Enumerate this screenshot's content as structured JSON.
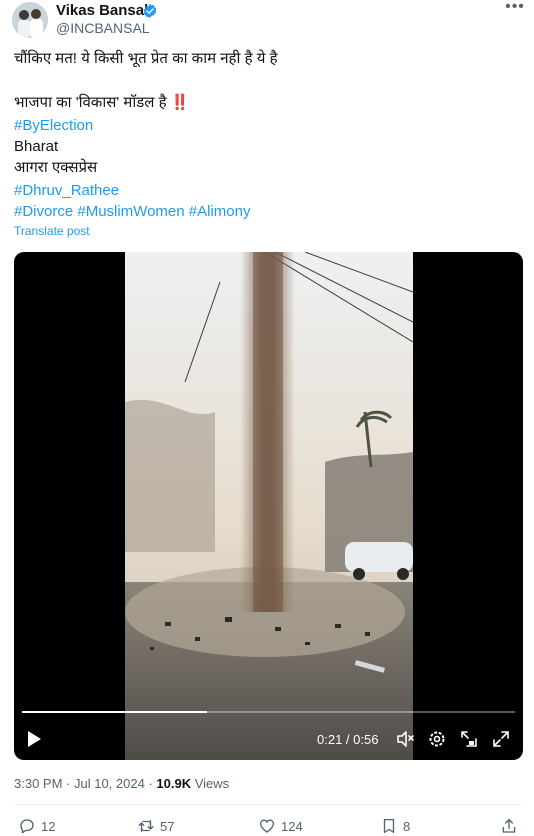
{
  "author": {
    "name": "Vikas Bansal",
    "handle": "@INCBANSAL"
  },
  "tweet": {
    "line1": "चौंकिए मत! ये किसी भूत प्रेत का काम नही है ये है",
    "line2": "भाजपा का 'विकास' मॉडल है",
    "line2_emoji": "‼️",
    "hashtag1": "#ByElection",
    "line4": "Bharat",
    "line5": "आगरा एक्सप्रेस",
    "hashtag2": "#Dhruv_Rathee",
    "hashtag3": "#Divorce",
    "hashtag4": "#MuslimWomen",
    "hashtag5": "#Alimony",
    "translate_label": "Translate post"
  },
  "video": {
    "current_time": "0:21",
    "separator": " / ",
    "duration": "0:56",
    "progress": 0.375
  },
  "meta": {
    "time": "3:30 PM",
    "dot": " · ",
    "date": "Jul 10, 2024",
    "views_count": "10.9K",
    "views_label": " Views"
  },
  "actions": {
    "replies": "12",
    "reposts": "57",
    "likes": "124",
    "bookmarks": "8"
  },
  "colors": {
    "accent": "#1d9bf0",
    "secondary_text": "#536471",
    "primary_text": "#0f1419"
  },
  "icons": [
    "verified-badge-icon",
    "more-icon",
    "play-icon",
    "volume-icon",
    "settings-icon",
    "pip-icon",
    "fullscreen-icon",
    "reply-icon",
    "repost-icon",
    "like-icon",
    "bookmark-icon",
    "share-icon"
  ]
}
